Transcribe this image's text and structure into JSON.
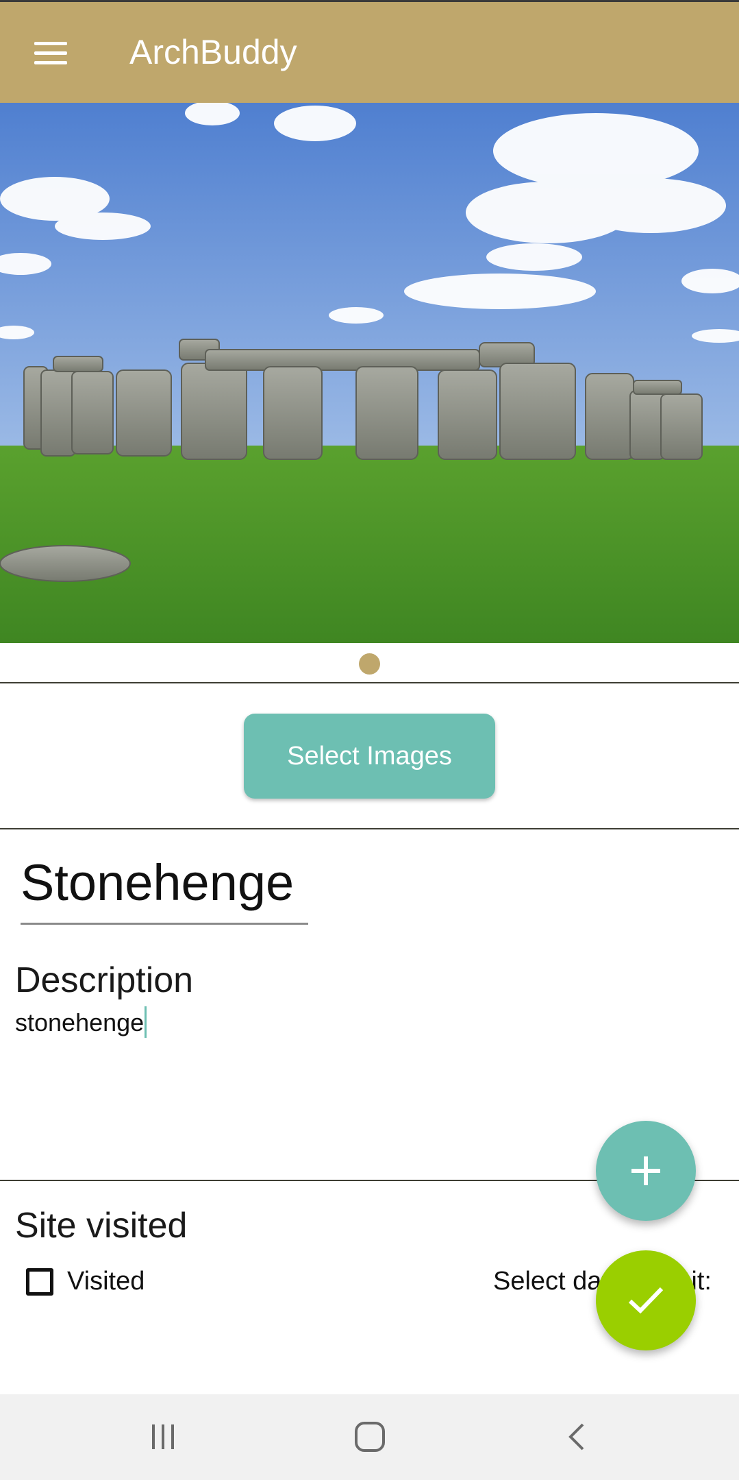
{
  "app_bar": {
    "title": "ArchBuddy",
    "menu_icon": "hamburger-menu-icon",
    "color": "#BFA76C"
  },
  "gallery": {
    "image_subject": "Stonehenge",
    "pager_dots": 1,
    "active_dot_color": "#BFA76C"
  },
  "actions": {
    "select_images_label": "Select Images",
    "accent_color": "#6DBFB2"
  },
  "site": {
    "name": "Stonehenge"
  },
  "description": {
    "label": "Description",
    "value": "stonehenge"
  },
  "visit": {
    "section_label": "Site visited",
    "checkbox_label": "Visited",
    "checkbox_checked": false,
    "date_label": "Select date of visit:"
  },
  "fabs": {
    "add_icon": "plus-icon",
    "save_icon": "check-icon",
    "save_color": "#9ACF00"
  },
  "system_nav": {
    "recents_icon": "recents-icon",
    "home_icon": "home-icon",
    "back_icon": "back-icon"
  }
}
